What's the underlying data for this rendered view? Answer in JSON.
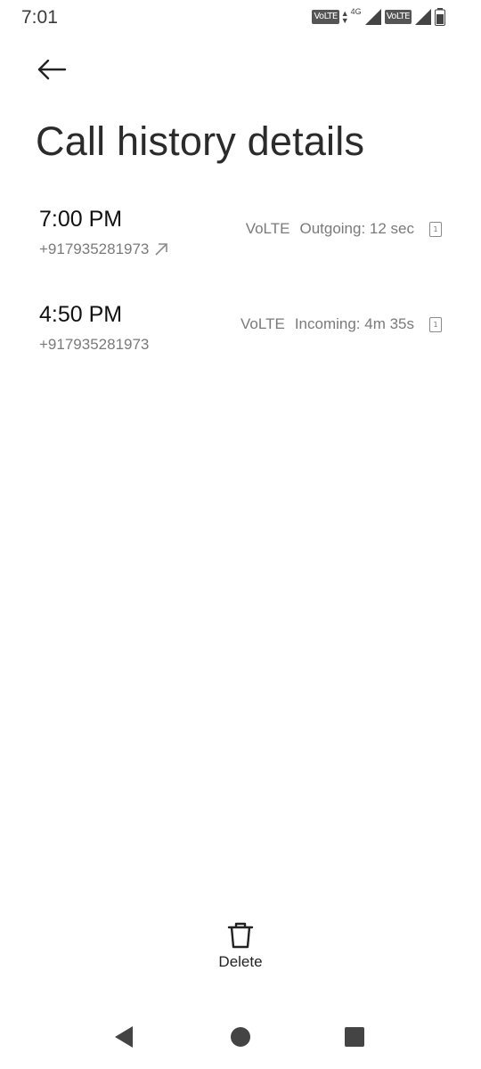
{
  "status_bar": {
    "time": "7:01",
    "sim1_tech": "VoLTE",
    "sim1_network": "4G",
    "sim2_tech": "VoLTE"
  },
  "header": {
    "title": "Call history details"
  },
  "calls": [
    {
      "time": "7:00 PM",
      "number": "+917935281973",
      "direction": "outgoing",
      "tech": "VoLTE",
      "detail": "Outgoing: 12 sec",
      "sim": "1"
    },
    {
      "time": "4:50 PM",
      "number": "+917935281973",
      "direction": "incoming",
      "tech": "VoLTE",
      "detail": "Incoming: 4m 35s",
      "sim": "1"
    }
  ],
  "actions": {
    "delete_label": "Delete"
  },
  "icons": {
    "back": "arrow-left-icon",
    "outgoing": "arrow-up-right-icon",
    "delete": "trash-icon",
    "nav_back": "triangle-back-icon",
    "nav_home": "circle-home-icon",
    "nav_recents": "square-recents-icon"
  }
}
